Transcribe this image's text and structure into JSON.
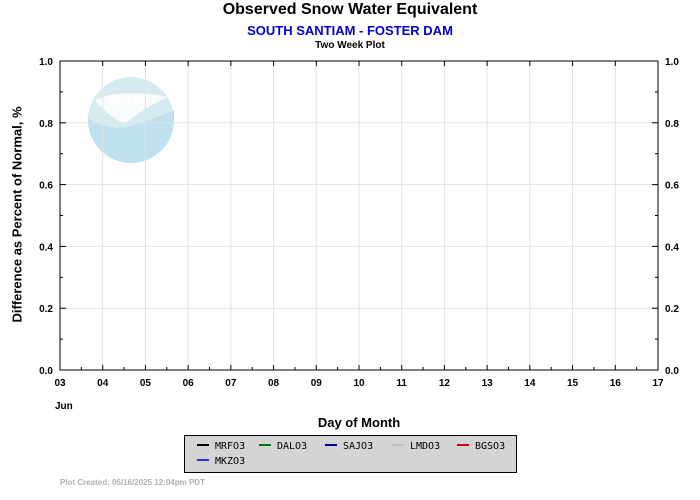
{
  "header": {
    "title": "Observed Snow Water Equivalent",
    "subtitle": "SOUTH SANTIAM - FOSTER DAM",
    "subsubtitle": "Two Week Plot"
  },
  "footer": {
    "created": "Plot Created:  06/16/2025 12:04pm PDT"
  },
  "logo": {
    "text": "NOAA",
    "icon": "noaa-logo"
  },
  "colors": {
    "subtitle": "#0000cc",
    "grid": "#e2e2e2",
    "legend_bg": "#d4d4d4"
  },
  "chart_data": {
    "type": "line",
    "title": "Observed Snow Water Equivalent",
    "xlabel": "Day of Month",
    "ylabel": "Difference as Percent of Normal, %",
    "x_month_label": "Jun",
    "x_ticks": [
      "03",
      "04",
      "05",
      "06",
      "07",
      "08",
      "09",
      "10",
      "11",
      "12",
      "13",
      "14",
      "15",
      "16",
      "17"
    ],
    "y_ticks": [
      "0.0",
      "0.2",
      "0.4",
      "0.6",
      "0.8",
      "1.0"
    ],
    "ylim": [
      0,
      1.0
    ],
    "grid": true,
    "legend_position": "bottom",
    "series": [
      {
        "name": "MRFO3",
        "color": "#000000",
        "values": []
      },
      {
        "name": "DALO3",
        "color": "#007700",
        "values": []
      },
      {
        "name": "SAJO3",
        "color": "#000099",
        "values": []
      },
      {
        "name": "LMDO3",
        "color": "#c0c0c0",
        "values": []
      },
      {
        "name": "BGSO3",
        "color": "#cc0000",
        "values": []
      },
      {
        "name": "MKZO3",
        "color": "#3333cc",
        "values": []
      }
    ]
  }
}
